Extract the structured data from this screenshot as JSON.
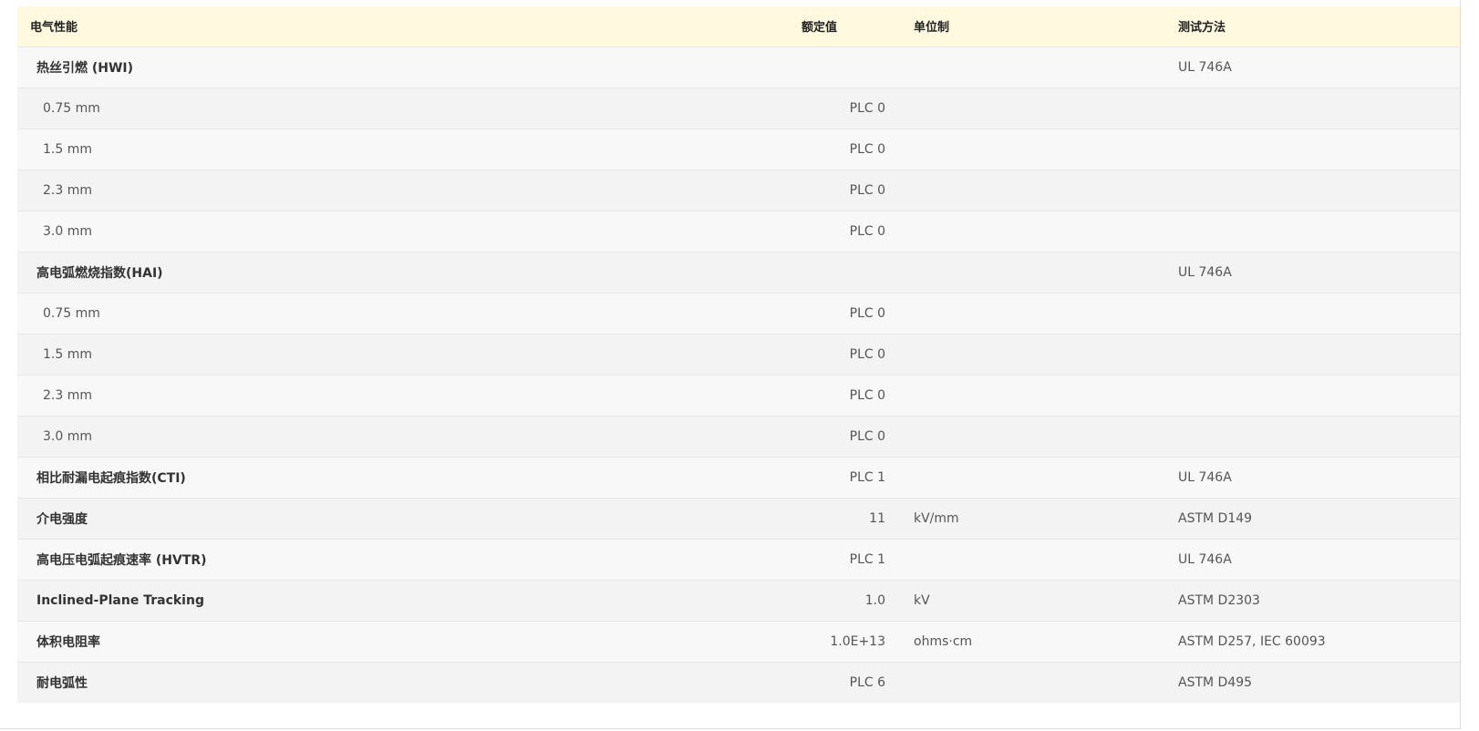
{
  "headers": {
    "property": "电气性能",
    "value": "额定值",
    "unit": "单位制",
    "method": "测试方法"
  },
  "rows": [
    {
      "property": "热丝引燃 (HWI)",
      "value": "",
      "unit": "",
      "method": "UL 746A",
      "kind": "main"
    },
    {
      "property": "0.75 mm",
      "value": "PLC 0",
      "unit": "",
      "method": "",
      "kind": "sub"
    },
    {
      "property": "1.5 mm",
      "value": "PLC 0",
      "unit": "",
      "method": "",
      "kind": "sub"
    },
    {
      "property": "2.3 mm",
      "value": "PLC 0",
      "unit": "",
      "method": "",
      "kind": "sub"
    },
    {
      "property": "3.0 mm",
      "value": "PLC 0",
      "unit": "",
      "method": "",
      "kind": "sub"
    },
    {
      "property": "高电弧燃烧指数(HAI)",
      "value": "",
      "unit": "",
      "method": "UL 746A",
      "kind": "main"
    },
    {
      "property": "0.75 mm",
      "value": "PLC 0",
      "unit": "",
      "method": "",
      "kind": "sub"
    },
    {
      "property": "1.5 mm",
      "value": "PLC 0",
      "unit": "",
      "method": "",
      "kind": "sub"
    },
    {
      "property": "2.3 mm",
      "value": "PLC 0",
      "unit": "",
      "method": "",
      "kind": "sub"
    },
    {
      "property": "3.0 mm",
      "value": "PLC 0",
      "unit": "",
      "method": "",
      "kind": "sub"
    },
    {
      "property": "相比耐漏电起痕指数(CTI)",
      "value": "PLC 1",
      "unit": "",
      "method": "UL 746A",
      "kind": "main"
    },
    {
      "property": "介电强度",
      "value": "11",
      "unit": "kV/mm",
      "method": "ASTM D149",
      "kind": "main"
    },
    {
      "property": "高电压电弧起痕速率 (HVTR)",
      "value": "PLC 1",
      "unit": "",
      "method": "UL 746A",
      "kind": "main"
    },
    {
      "property": "Inclined-Plane Tracking",
      "value": "1.0",
      "unit": "kV",
      "method": "ASTM D2303",
      "kind": "main"
    },
    {
      "property": "体积电阻率",
      "value": "1.0E+13",
      "unit": "ohms·cm",
      "method": "ASTM D257, IEC 60093",
      "kind": "main"
    },
    {
      "property": "耐电弧性",
      "value": "PLC 6",
      "unit": "",
      "method": "ASTM D495",
      "kind": "main"
    }
  ]
}
